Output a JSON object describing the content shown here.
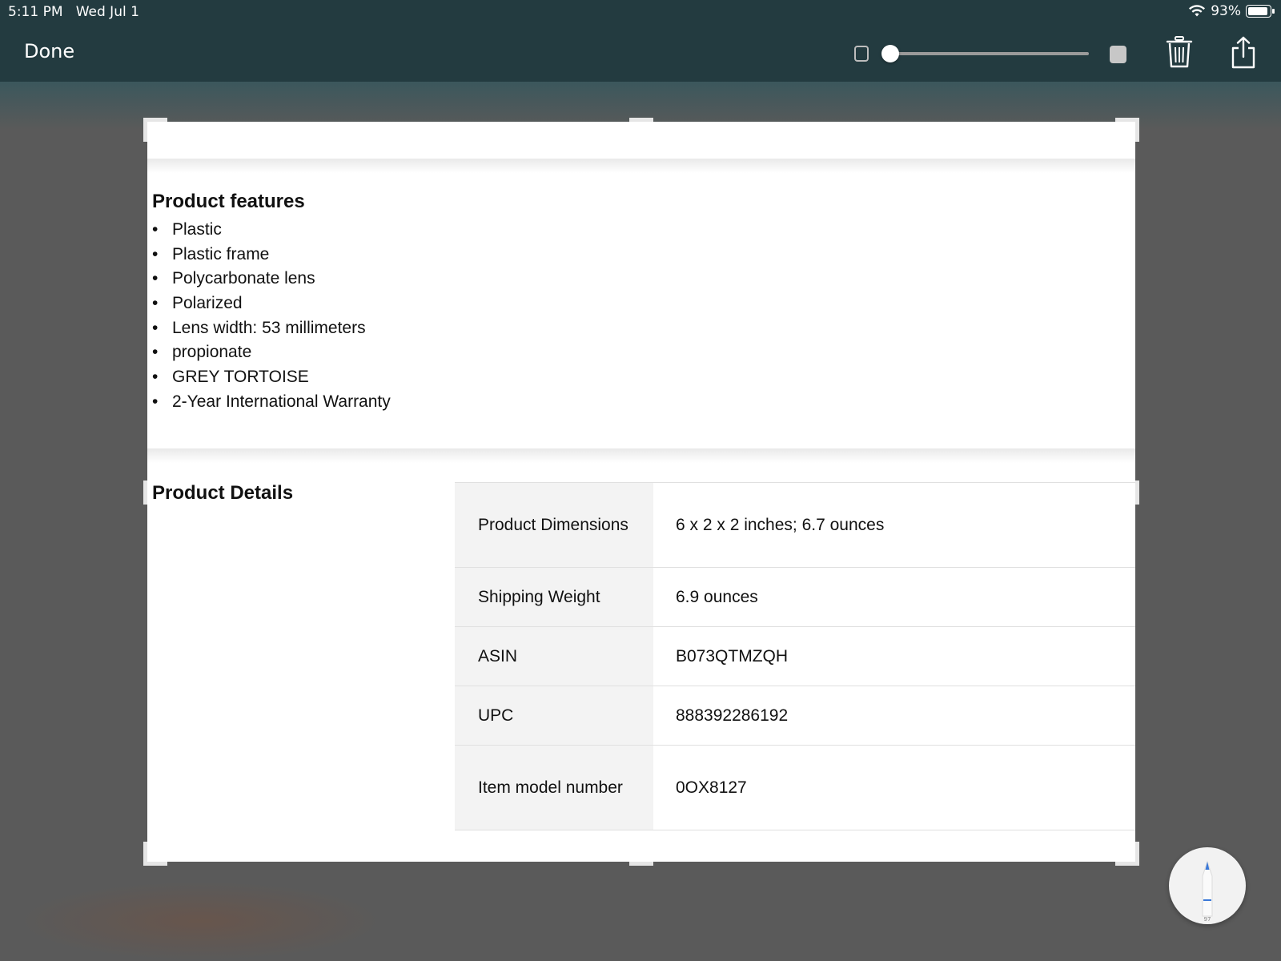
{
  "status_bar": {
    "time": "5:11 PM",
    "date": "Wed Jul 1",
    "battery_percent": "93%"
  },
  "toolbar": {
    "done_label": "Done",
    "opacity_slider_value": 0.0,
    "icons": [
      "small-square-icon",
      "large-square-icon",
      "trash-icon",
      "share-icon"
    ]
  },
  "document": {
    "features_title": "Product features",
    "features": [
      "Plastic",
      "Plastic frame",
      "Polycarbonate lens",
      "Polarized",
      "Lens width: 53 millimeters",
      "propionate",
      "GREY TORTOISE",
      "2-Year International Warranty"
    ],
    "details_title": "Product Details",
    "details": [
      {
        "label": "Product Dimensions",
        "value": "6 x 2 x 2 inches; 6.7 ounces"
      },
      {
        "label": "Shipping Weight",
        "value": "6.9 ounces"
      },
      {
        "label": "ASIN",
        "value": "B073QTMZQH"
      },
      {
        "label": "UPC",
        "value": "888392286192"
      },
      {
        "label": "Item model number",
        "value": "0OX8127"
      }
    ]
  },
  "pencil_button": {
    "icon": "pencil-tool-icon",
    "label": "97",
    "accent": "#3a78d8"
  }
}
